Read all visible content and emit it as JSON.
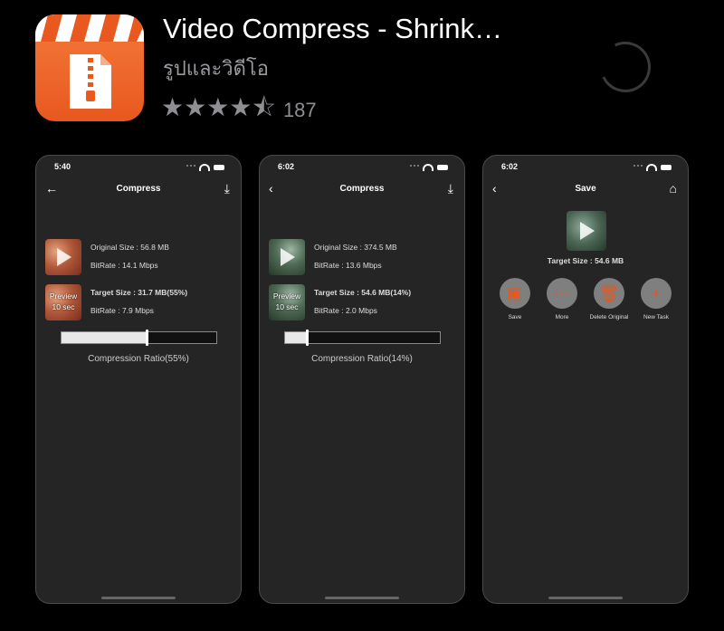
{
  "app": {
    "title": "Video Compress - Shrink…",
    "category": "รูปและวิดีโอ",
    "stars": "★★★★⯪",
    "rating_value": 4.5,
    "rating_count": "187",
    "accent": "#e8581f"
  },
  "screens": [
    {
      "time": "5:40",
      "title": "Compress",
      "original_size": "Original Size : 56.8 MB",
      "original_bitrate": "BitRate : 14.1 Mbps",
      "preview_line1": "Preview",
      "preview_line2": "10 sec",
      "target_size": "Target Size : 31.7 MB(55%)",
      "target_bitrate": "BitRate : 7.9 Mbps",
      "ratio_label": "Compression Ratio(55%)",
      "ratio": 0.55
    },
    {
      "time": "6:02",
      "title": "Compress",
      "original_size": "Original Size : 374.5 MB",
      "original_bitrate": "BitRate : 13.6 Mbps",
      "preview_line1": "Preview",
      "preview_line2": "10 sec",
      "target_size": "Target Size : 54.6 MB(14%)",
      "target_bitrate": "BitRate : 2.0 Mbps",
      "ratio_label": "Compression Ratio(14%)",
      "ratio": 0.14
    },
    {
      "time": "6:02",
      "title": "Save",
      "target_size": "Target Size : 54.6 MB",
      "actions": [
        "Save",
        "More",
        "Delete Original",
        "New Task"
      ]
    }
  ]
}
